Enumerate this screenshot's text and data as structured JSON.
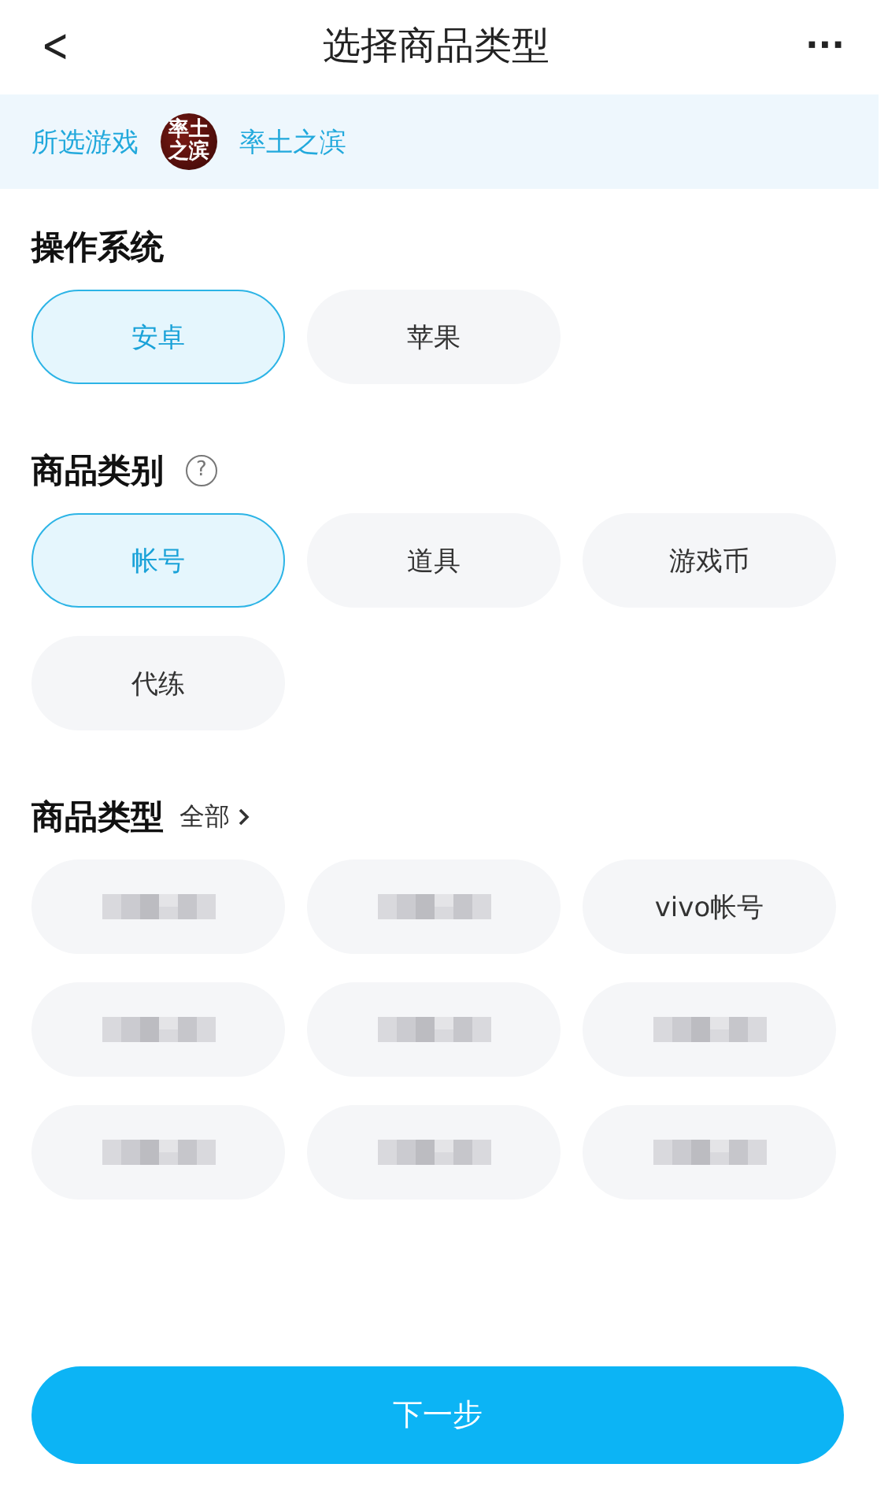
{
  "header": {
    "back": "<",
    "title": "选择商品类型",
    "more": "···"
  },
  "selected_game": {
    "label": "所选游戏",
    "logo_text": "率土之滨",
    "name": "率土之滨"
  },
  "os": {
    "title": "操作系统",
    "options": [
      {
        "label": "安卓",
        "selected": true
      },
      {
        "label": "苹果",
        "selected": false
      }
    ]
  },
  "category": {
    "title": "商品类别",
    "help": "?",
    "options": [
      {
        "label": "帐号",
        "selected": true
      },
      {
        "label": "道具",
        "selected": false
      },
      {
        "label": "游戏币",
        "selected": false
      },
      {
        "label": "代练",
        "selected": false
      }
    ]
  },
  "type": {
    "title": "商品类型",
    "all_link": "全部",
    "options": [
      {
        "kind": "redacted"
      },
      {
        "kind": "redacted"
      },
      {
        "kind": "text",
        "label": "vivo帐号"
      },
      {
        "kind": "redacted"
      },
      {
        "kind": "redacted"
      },
      {
        "kind": "redacted"
      },
      {
        "kind": "redacted"
      },
      {
        "kind": "redacted"
      },
      {
        "kind": "redacted"
      }
    ]
  },
  "next_button": "下一步"
}
